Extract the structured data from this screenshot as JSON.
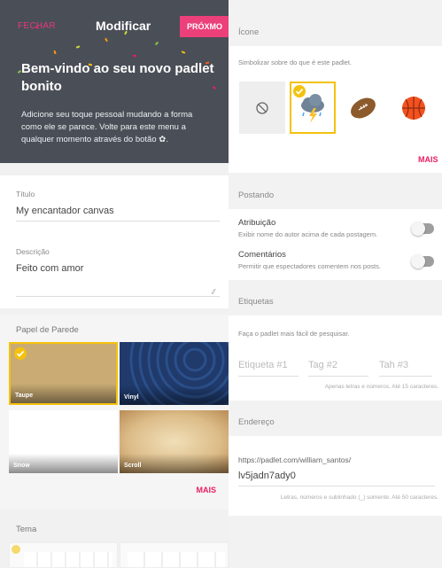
{
  "header": {
    "close_label": "FECHAR",
    "title": "Modificar",
    "next_label": "PRÓXMO"
  },
  "welcome": {
    "heading": "Bem-vindo ao seu novo padlet bonito",
    "body": "Adicione seu toque pessoal mudando a forma como ele se parece. Volte para este menu a qualquer momento através do botão ✿."
  },
  "form": {
    "title_label": "Título",
    "title_value": "My encantador canvas",
    "description_label": "Descrição",
    "description_value": "Feito com amor"
  },
  "wallpaper": {
    "header": "Papel de Parede",
    "tiles": [
      {
        "label": "Taupe",
        "selected": true
      },
      {
        "label": "Vinyl",
        "selected": false
      },
      {
        "label": "Snow",
        "selected": false
      },
      {
        "label": "Scroll",
        "selected": false
      }
    ],
    "more_label": "MAIS"
  },
  "theme": {
    "header": "Tema"
  },
  "icon_section": {
    "header": "Ícone",
    "hint": "Simbolizar sobre do que é este padlet.",
    "icons": [
      "no-icon",
      "storm-cloud-icon",
      "football-icon",
      "basketball-icon"
    ],
    "selected_icon": "storm-cloud-icon",
    "more_label": "MAIS"
  },
  "posting": {
    "header": "Postando",
    "attribution_title": "Atribuição",
    "attribution_desc": "Exibir nome do autor acima de cada postagem.",
    "comments_title": "Comentários",
    "comments_desc": "Permitir que espectadores comentem nos posts."
  },
  "tags": {
    "header": "Etiquetas",
    "hint": "Faça o padlet mais fácil de pesquisar.",
    "placeholders": [
      "Etiqueta #1",
      "Tag #2",
      "Tah #3"
    ],
    "footnote": "Apenas letras e números. Até 15 caracteres."
  },
  "address": {
    "header": "Endereço",
    "prefix": "https://padlet.com/william_santos/",
    "slug": "lv5jadn7ady0",
    "footnote": "Letras, números e sublinhado (_) somente. Até 50 caracteres."
  },
  "colors": {
    "accent": "#ec407a",
    "hero_bg": "#4a4f57",
    "selected_border": "#f4c20d"
  }
}
